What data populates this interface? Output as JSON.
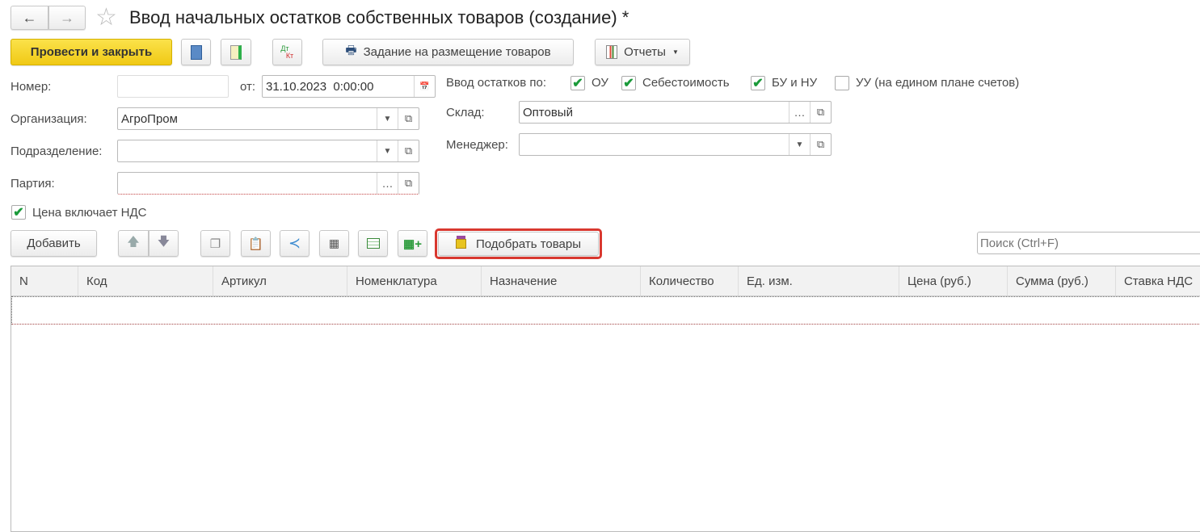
{
  "title": "Ввод начальных остатков собственных товаров (создание) *",
  "nav": {
    "back": "back-arrow-icon",
    "forward": "forward-arrow-icon",
    "favorite": "star-icon"
  },
  "toolbar": {
    "post_close": "Провести и закрыть",
    "dtkt_top": "Дт",
    "dtkt_bottom": "Кт",
    "task": "Задание на размещение товаров",
    "reports": "Отчеты"
  },
  "form": {
    "number_label": "Номер:",
    "number_value": "",
    "date_label": "от:",
    "date_value": "31.10.2023  0:00:00",
    "org_label": "Организация:",
    "org_value": "АгроПром",
    "dept_label": "Подразделение:",
    "dept_value": "",
    "batch_label": "Партия:",
    "batch_value": "",
    "vat_label": "Цена включает НДС",
    "vat_checked": true,
    "input_by_label": "Ввод остатков по:",
    "flags": [
      {
        "label": "ОУ",
        "checked": true
      },
      {
        "label": "Себестоимость",
        "checked": true
      },
      {
        "label": "БУ и НУ",
        "checked": true
      },
      {
        "label": "УУ (на едином плане счетов)",
        "checked": false
      }
    ],
    "warehouse_label": "Склад:",
    "warehouse_value": "Оптовый",
    "manager_label": "Менеджер:",
    "manager_value": ""
  },
  "table_toolbar": {
    "add": "Добавить",
    "pick": "Подобрать товары",
    "search_placeholder": "Поиск (Ctrl+F)",
    "highlight_color": "#d9382f"
  },
  "table": {
    "columns": [
      "N",
      "Код",
      "Артикул",
      "Номенклатура",
      "Назначение",
      "Количество",
      "Ед. изм.",
      "Цена (руб.)",
      "Сумма (руб.)",
      "Ставка НДС"
    ],
    "rows": []
  },
  "colors": {
    "primary_button": "#f5d527",
    "check": "#1a9a3a"
  }
}
